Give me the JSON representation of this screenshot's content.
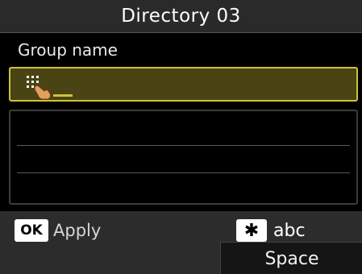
{
  "header": {
    "title": "Directory 03"
  },
  "form": {
    "field_label": "Group name",
    "input_value": "",
    "input_icon": "keypad-touch-icon"
  },
  "footer": {
    "ok_key": "OK",
    "apply_label": "Apply",
    "mode_key": "✱",
    "mode_label": "abc",
    "space_label": "Space"
  },
  "colors": {
    "focus_border": "#cfc23a",
    "focus_fill": "#4a4414",
    "background": "#000000",
    "bar": "#2c2c2c"
  }
}
